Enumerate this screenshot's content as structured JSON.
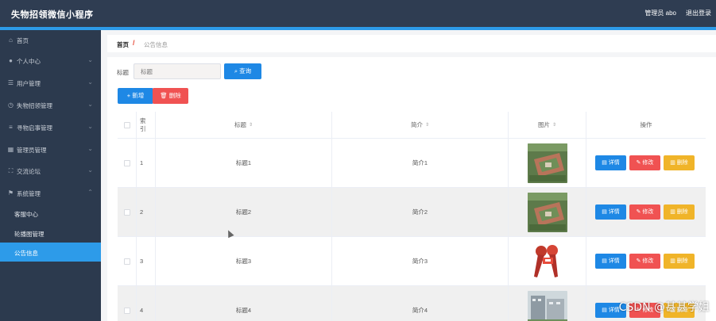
{
  "header": {
    "app_title": "失物招领微信小程序",
    "user_label": "管理员 abo",
    "logout_label": "退出登录"
  },
  "sidebar": {
    "items": [
      {
        "label": "首页",
        "icon": "home-icon"
      },
      {
        "label": "个人中心",
        "icon": "user-icon"
      },
      {
        "label": "用户管理",
        "icon": "list-icon"
      },
      {
        "label": "失物招领管理",
        "icon": "clock-icon"
      },
      {
        "label": "寻物启事管理",
        "icon": "menu-icon"
      },
      {
        "label": "管理员管理",
        "icon": "admin-icon"
      },
      {
        "label": "交流论坛",
        "icon": "forum-icon"
      },
      {
        "label": "系统管理",
        "icon": "flag-icon"
      }
    ],
    "sub_items": [
      {
        "label": "客服中心"
      },
      {
        "label": "轮播图管理"
      },
      {
        "label": "公告信息"
      }
    ]
  },
  "breadcrumb": {
    "home": "首页",
    "separator": "/",
    "current": "公告信息"
  },
  "search": {
    "label": "标题",
    "placeholder": "标题",
    "query_button": "查询"
  },
  "actions": {
    "add_button": "新增",
    "delete_button": "删除"
  },
  "table": {
    "headers": {
      "index": "索引",
      "title": "标题",
      "intro": "简介",
      "picture": "图片",
      "operations": "操作"
    },
    "op_labels": {
      "view": "详情",
      "edit": "修改",
      "delete": "删除"
    },
    "rows": [
      {
        "index": "1",
        "title": "标题1",
        "intro": "简介1",
        "picture": "campus-aerial-image"
      },
      {
        "index": "2",
        "title": "标题2",
        "intro": "简介2",
        "picture": "campus-aerial-image"
      },
      {
        "index": "3",
        "title": "标题3",
        "intro": "简介3",
        "picture": "microphones-image"
      },
      {
        "index": "4",
        "title": "标题4",
        "intro": "简介4",
        "picture": "building-image"
      }
    ]
  },
  "watermark": "CSDN @甚甚学姐",
  "colors": {
    "header_bg": "#2f3d52",
    "sidebar_bg": "#2c3a4e",
    "accent": "#2d9be9",
    "primary": "#1e88e5",
    "danger": "#f05252",
    "warning": "#f0b429"
  }
}
